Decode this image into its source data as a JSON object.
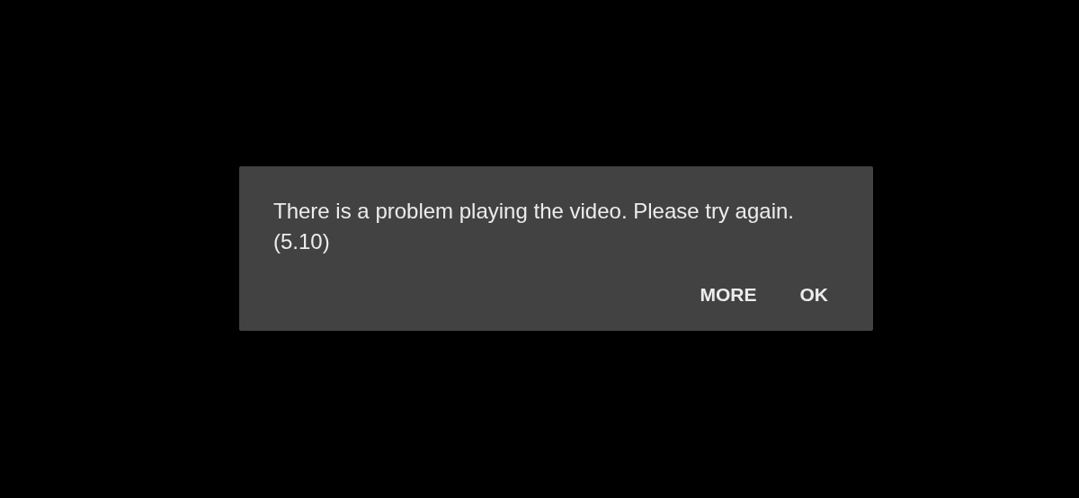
{
  "dialog": {
    "message": "There is a problem playing the video. Please try again. (5.10)",
    "buttons": [
      "MORE",
      "OK"
    ]
  }
}
